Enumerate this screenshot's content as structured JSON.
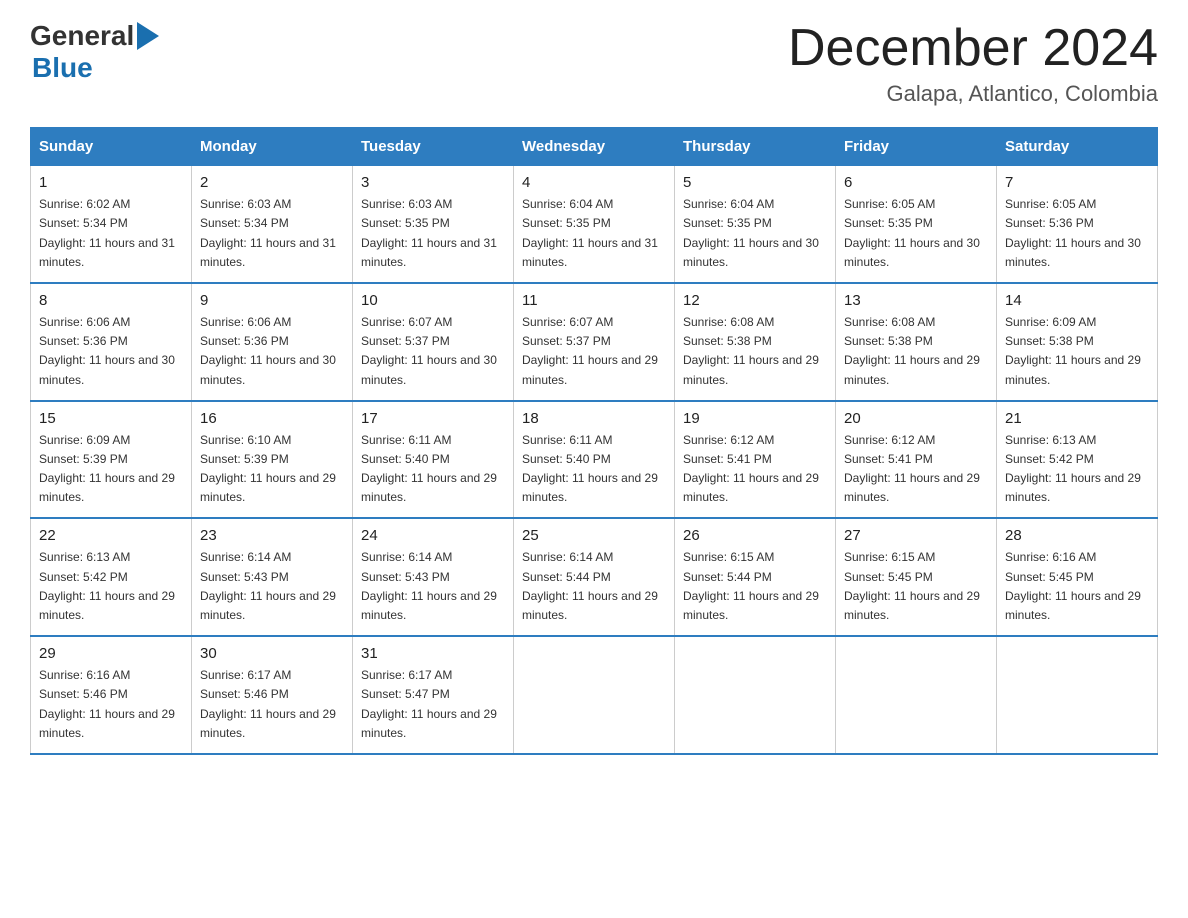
{
  "header": {
    "logo_general": "General",
    "logo_blue": "Blue",
    "month_title": "December 2024",
    "location": "Galapa, Atlantico, Colombia"
  },
  "days_of_week": [
    "Sunday",
    "Monday",
    "Tuesday",
    "Wednesday",
    "Thursday",
    "Friday",
    "Saturday"
  ],
  "weeks": [
    [
      {
        "day": "1",
        "sunrise": "6:02 AM",
        "sunset": "5:34 PM",
        "daylight": "11 hours and 31 minutes."
      },
      {
        "day": "2",
        "sunrise": "6:03 AM",
        "sunset": "5:34 PM",
        "daylight": "11 hours and 31 minutes."
      },
      {
        "day": "3",
        "sunrise": "6:03 AM",
        "sunset": "5:35 PM",
        "daylight": "11 hours and 31 minutes."
      },
      {
        "day": "4",
        "sunrise": "6:04 AM",
        "sunset": "5:35 PM",
        "daylight": "11 hours and 31 minutes."
      },
      {
        "day": "5",
        "sunrise": "6:04 AM",
        "sunset": "5:35 PM",
        "daylight": "11 hours and 30 minutes."
      },
      {
        "day": "6",
        "sunrise": "6:05 AM",
        "sunset": "5:35 PM",
        "daylight": "11 hours and 30 minutes."
      },
      {
        "day": "7",
        "sunrise": "6:05 AM",
        "sunset": "5:36 PM",
        "daylight": "11 hours and 30 minutes."
      }
    ],
    [
      {
        "day": "8",
        "sunrise": "6:06 AM",
        "sunset": "5:36 PM",
        "daylight": "11 hours and 30 minutes."
      },
      {
        "day": "9",
        "sunrise": "6:06 AM",
        "sunset": "5:36 PM",
        "daylight": "11 hours and 30 minutes."
      },
      {
        "day": "10",
        "sunrise": "6:07 AM",
        "sunset": "5:37 PM",
        "daylight": "11 hours and 30 minutes."
      },
      {
        "day": "11",
        "sunrise": "6:07 AM",
        "sunset": "5:37 PM",
        "daylight": "11 hours and 29 minutes."
      },
      {
        "day": "12",
        "sunrise": "6:08 AM",
        "sunset": "5:38 PM",
        "daylight": "11 hours and 29 minutes."
      },
      {
        "day": "13",
        "sunrise": "6:08 AM",
        "sunset": "5:38 PM",
        "daylight": "11 hours and 29 minutes."
      },
      {
        "day": "14",
        "sunrise": "6:09 AM",
        "sunset": "5:38 PM",
        "daylight": "11 hours and 29 minutes."
      }
    ],
    [
      {
        "day": "15",
        "sunrise": "6:09 AM",
        "sunset": "5:39 PM",
        "daylight": "11 hours and 29 minutes."
      },
      {
        "day": "16",
        "sunrise": "6:10 AM",
        "sunset": "5:39 PM",
        "daylight": "11 hours and 29 minutes."
      },
      {
        "day": "17",
        "sunrise": "6:11 AM",
        "sunset": "5:40 PM",
        "daylight": "11 hours and 29 minutes."
      },
      {
        "day": "18",
        "sunrise": "6:11 AM",
        "sunset": "5:40 PM",
        "daylight": "11 hours and 29 minutes."
      },
      {
        "day": "19",
        "sunrise": "6:12 AM",
        "sunset": "5:41 PM",
        "daylight": "11 hours and 29 minutes."
      },
      {
        "day": "20",
        "sunrise": "6:12 AM",
        "sunset": "5:41 PM",
        "daylight": "11 hours and 29 minutes."
      },
      {
        "day": "21",
        "sunrise": "6:13 AM",
        "sunset": "5:42 PM",
        "daylight": "11 hours and 29 minutes."
      }
    ],
    [
      {
        "day": "22",
        "sunrise": "6:13 AM",
        "sunset": "5:42 PM",
        "daylight": "11 hours and 29 minutes."
      },
      {
        "day": "23",
        "sunrise": "6:14 AM",
        "sunset": "5:43 PM",
        "daylight": "11 hours and 29 minutes."
      },
      {
        "day": "24",
        "sunrise": "6:14 AM",
        "sunset": "5:43 PM",
        "daylight": "11 hours and 29 minutes."
      },
      {
        "day": "25",
        "sunrise": "6:14 AM",
        "sunset": "5:44 PM",
        "daylight": "11 hours and 29 minutes."
      },
      {
        "day": "26",
        "sunrise": "6:15 AM",
        "sunset": "5:44 PM",
        "daylight": "11 hours and 29 minutes."
      },
      {
        "day": "27",
        "sunrise": "6:15 AM",
        "sunset": "5:45 PM",
        "daylight": "11 hours and 29 minutes."
      },
      {
        "day": "28",
        "sunrise": "6:16 AM",
        "sunset": "5:45 PM",
        "daylight": "11 hours and 29 minutes."
      }
    ],
    [
      {
        "day": "29",
        "sunrise": "6:16 AM",
        "sunset": "5:46 PM",
        "daylight": "11 hours and 29 minutes."
      },
      {
        "day": "30",
        "sunrise": "6:17 AM",
        "sunset": "5:46 PM",
        "daylight": "11 hours and 29 minutes."
      },
      {
        "day": "31",
        "sunrise": "6:17 AM",
        "sunset": "5:47 PM",
        "daylight": "11 hours and 29 minutes."
      },
      null,
      null,
      null,
      null
    ]
  ]
}
